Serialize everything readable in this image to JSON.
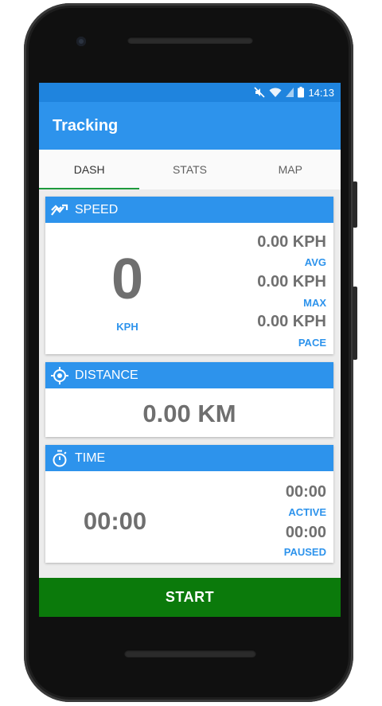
{
  "statusbar": {
    "time": "14:13"
  },
  "appbar": {
    "title": "Tracking"
  },
  "tabs": [
    {
      "label": "DASH",
      "active": true
    },
    {
      "label": "STATS",
      "active": false
    },
    {
      "label": "MAP",
      "active": false
    }
  ],
  "speed": {
    "header": "SPEED",
    "icon": "trending-icon",
    "current": "0",
    "current_unit": "KPH",
    "avg_value": "0.00 KPH",
    "avg_label": "AVG",
    "max_value": "0.00 KPH",
    "max_label": "MAX",
    "pace_value": "0.00 KPH",
    "pace_label": "PACE"
  },
  "distance": {
    "header": "DISTANCE",
    "icon": "crosshair-icon",
    "value": "0.00 KM"
  },
  "time": {
    "header": "TIME",
    "icon": "stopwatch-icon",
    "total": "00:00",
    "active_value": "00:00",
    "active_label": "ACTIVE",
    "paused_value": "00:00",
    "paused_label": "PAUSED"
  },
  "start_button": {
    "label": "START"
  },
  "colors": {
    "primary": "#2d93ec",
    "statusbar": "#1f84de",
    "start": "#0b7a0b",
    "tab_indicator": "#1e9a3c"
  }
}
